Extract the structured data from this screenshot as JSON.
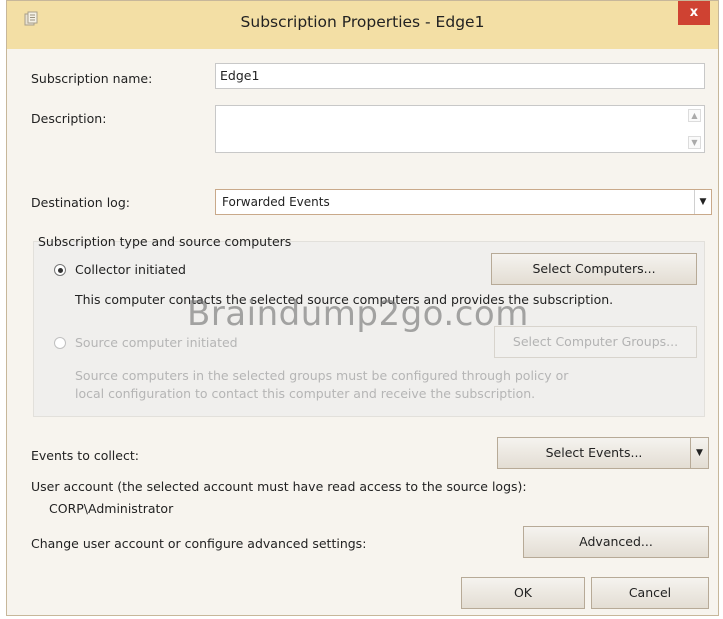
{
  "window": {
    "title": "Subscription Properties - Edge1",
    "close_label": "x"
  },
  "form": {
    "subscription_name_label": "Subscription name:",
    "subscription_name_value": "Edge1",
    "description_label": "Description:",
    "description_value": "",
    "destination_log_label": "Destination log:",
    "destination_log_value": "Forwarded Events"
  },
  "source_group": {
    "title": "Subscription type and source computers",
    "collector_label": "Collector initiated",
    "collector_selected": true,
    "select_computers_button": "Select Computers...",
    "collector_description": "This computer contacts the selected source computers and provides the subscription.",
    "source_label": "Source computer initiated",
    "source_selected": false,
    "select_groups_button": "Select Computer Groups...",
    "source_description_line1": "Source computers in the selected groups must be configured through policy or",
    "source_description_line2": "local configuration to contact this computer and receive the subscription."
  },
  "events": {
    "label": "Events to collect:",
    "select_events_button": "Select Events..."
  },
  "account": {
    "label": "User account (the selected account must have read access to the source logs):",
    "value": "CORP\\Administrator",
    "advanced_label": "Change user account or configure advanced settings:",
    "advanced_button": "Advanced..."
  },
  "footer": {
    "ok_button": "OK",
    "cancel_button": "Cancel"
  },
  "watermark": "Braindump2go.com",
  "colors": {
    "titlebar": "#f3dfa5",
    "close": "#cf4232",
    "window_bg": "#f7f4ee"
  }
}
